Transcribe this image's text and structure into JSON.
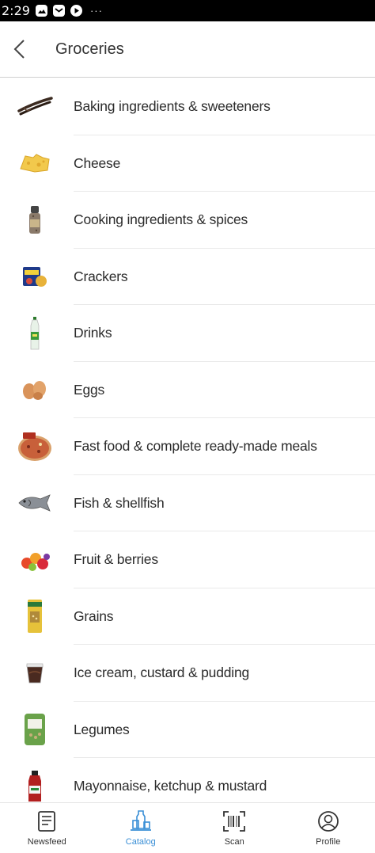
{
  "status_bar": {
    "time": "2:29",
    "dots": "···"
  },
  "header": {
    "title": "Groceries"
  },
  "categories": [
    {
      "label": "Baking ingredients & sweeteners",
      "icon": "vanilla-pods-icon"
    },
    {
      "label": "Cheese",
      "icon": "cheese-icon"
    },
    {
      "label": "Cooking ingredients & spices",
      "icon": "spice-grinder-icon"
    },
    {
      "label": "Crackers",
      "icon": "crackers-icon"
    },
    {
      "label": "Drinks",
      "icon": "bottle-icon"
    },
    {
      "label": "Eggs",
      "icon": "eggs-icon"
    },
    {
      "label": "Fast food & complete ready-made meals",
      "icon": "pizza-icon"
    },
    {
      "label": "Fish & shellfish",
      "icon": "fish-icon"
    },
    {
      "label": "Fruit & berries",
      "icon": "fruit-icon"
    },
    {
      "label": "Grains",
      "icon": "grains-bag-icon"
    },
    {
      "label": "Ice cream, custard & pudding",
      "icon": "pudding-cup-icon"
    },
    {
      "label": "Legumes",
      "icon": "legumes-bag-icon"
    },
    {
      "label": "Mayonnaise, ketchup & mustard",
      "icon": "ketchup-bottle-icon"
    }
  ],
  "bottom_nav": {
    "items": [
      {
        "label": "Newsfeed",
        "icon": "newspaper-icon",
        "active": false
      },
      {
        "label": "Catalog",
        "icon": "catalog-bottles-icon",
        "active": true
      },
      {
        "label": "Scan",
        "icon": "barcode-scan-icon",
        "active": false
      },
      {
        "label": "Profile",
        "icon": "profile-icon",
        "active": false
      }
    ]
  },
  "colors": {
    "accent": "#3a8fd6",
    "text": "#2b2b2b",
    "divider": "#e9e9e9",
    "status_bar": "#000000"
  }
}
